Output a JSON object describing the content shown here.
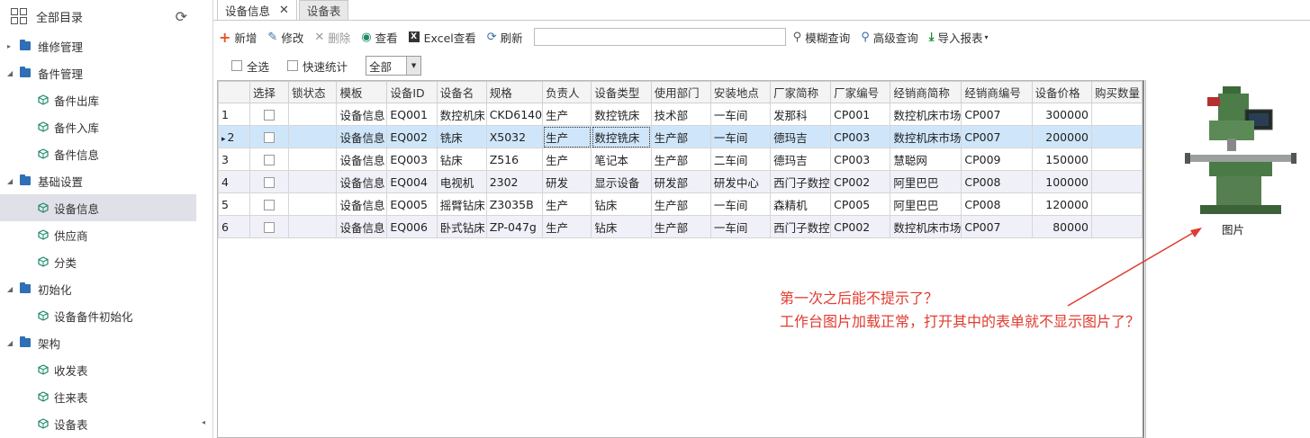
{
  "sidebar": {
    "title": "全部目录",
    "items": [
      {
        "label": "维修管理",
        "level": 1,
        "expanded": false
      },
      {
        "label": "备件管理",
        "level": 1,
        "expanded": true
      },
      {
        "label": "备件出库",
        "level": 2
      },
      {
        "label": "备件入库",
        "level": 2
      },
      {
        "label": "备件信息",
        "level": 2
      },
      {
        "label": "基础设置",
        "level": 1,
        "expanded": true
      },
      {
        "label": "设备信息",
        "level": 2,
        "active": true
      },
      {
        "label": "供应商",
        "level": 2
      },
      {
        "label": "分类",
        "level": 2
      },
      {
        "label": "初始化",
        "level": 1,
        "expanded": true
      },
      {
        "label": "设备备件初始化",
        "level": 2
      },
      {
        "label": "架构",
        "level": 1,
        "expanded": true
      },
      {
        "label": "收发表",
        "level": 2
      },
      {
        "label": "往来表",
        "level": 2
      },
      {
        "label": "设备表",
        "level": 2
      }
    ]
  },
  "tabs": [
    {
      "label": "设备信息",
      "active": true,
      "close": "✕"
    },
    {
      "label": "设备表",
      "active": false
    }
  ],
  "toolbar": {
    "add": "新增",
    "edit": "修改",
    "delete": "删除",
    "view": "查看",
    "excel_view": "Excel查看",
    "excel_icon": "X",
    "refresh": "刷新",
    "search_value": "",
    "fuzzy_query": "模糊查询",
    "advanced_query": "高级查询",
    "import_report": "导入报表"
  },
  "filter": {
    "select_all": "全选",
    "quick_stats": "快速统计",
    "scope_value": "全部"
  },
  "grid": {
    "columns": [
      "",
      "选择",
      "锁状态",
      "模板",
      "设备ID",
      "设备名",
      "规格",
      "负责人",
      "设备类型",
      "使用部门",
      "安装地点",
      "厂家简称",
      "厂家编号",
      "经销商简称",
      "经销商编号",
      "设备价格",
      "购买数量"
    ],
    "rows": [
      {
        "n": "1",
        "template": "设备信息",
        "id": "EQ001",
        "name": "数控机床",
        "spec": "CKD6140",
        "owner": "生产",
        "type": "数控铣床",
        "dept": "技术部",
        "location": "一车间",
        "maker": "发那科",
        "maker_no": "CP001",
        "dealer": "数控机床市场",
        "dealer_no": "CP007",
        "price": "300000",
        "qty": ""
      },
      {
        "n": "2",
        "template": "设备信息",
        "id": "EQ002",
        "name": "铣床",
        "spec": "X5032",
        "owner": "生产",
        "type": "数控铣床",
        "dept": "生产部",
        "location": "一车间",
        "maker": "德玛吉",
        "maker_no": "CP003",
        "dealer": "数控机床市场",
        "dealer_no": "CP007",
        "price": "200000",
        "qty": ""
      },
      {
        "n": "3",
        "template": "设备信息",
        "id": "EQ003",
        "name": "钻床",
        "spec": "Z516",
        "owner": "生产",
        "type": "笔记本",
        "dept": "生产部",
        "location": "二车间",
        "maker": "德玛吉",
        "maker_no": "CP003",
        "dealer": "慧聪网",
        "dealer_no": "CP009",
        "price": "150000",
        "qty": ""
      },
      {
        "n": "4",
        "template": "设备信息",
        "id": "EQ004",
        "name": "电视机",
        "spec": "2302",
        "owner": "研发",
        "type": "显示设备",
        "dept": "研发部",
        "location": "研发中心",
        "maker": "西门子数控",
        "maker_no": "CP002",
        "dealer": "阿里巴巴",
        "dealer_no": "CP008",
        "price": "100000",
        "qty": ""
      },
      {
        "n": "5",
        "template": "设备信息",
        "id": "EQ005",
        "name": "摇臂钻床",
        "spec": "Z3035B",
        "owner": "生产",
        "type": "钻床",
        "dept": "生产部",
        "location": "一车间",
        "maker": "森精机",
        "maker_no": "CP005",
        "dealer": "阿里巴巴",
        "dealer_no": "CP008",
        "price": "120000",
        "qty": ""
      },
      {
        "n": "6",
        "template": "设备信息",
        "id": "EQ006",
        "name": "卧式钻床",
        "spec": "ZP-047g",
        "owner": "生产",
        "type": "钻床",
        "dept": "生产部",
        "location": "一车间",
        "maker": "西门子数控",
        "maker_no": "CP002",
        "dealer": "数控机床市场",
        "dealer_no": "CP007",
        "price": "80000",
        "qty": ""
      }
    ],
    "selected_row": 2,
    "row_marker": "▸"
  },
  "image_panel": {
    "caption": "图片"
  },
  "annotation": {
    "line1": "第一次之后能不提示了？",
    "line2": "工作台图片加载正常，打开其中的表单就不显示图片了？",
    "color": "#e03c31"
  }
}
